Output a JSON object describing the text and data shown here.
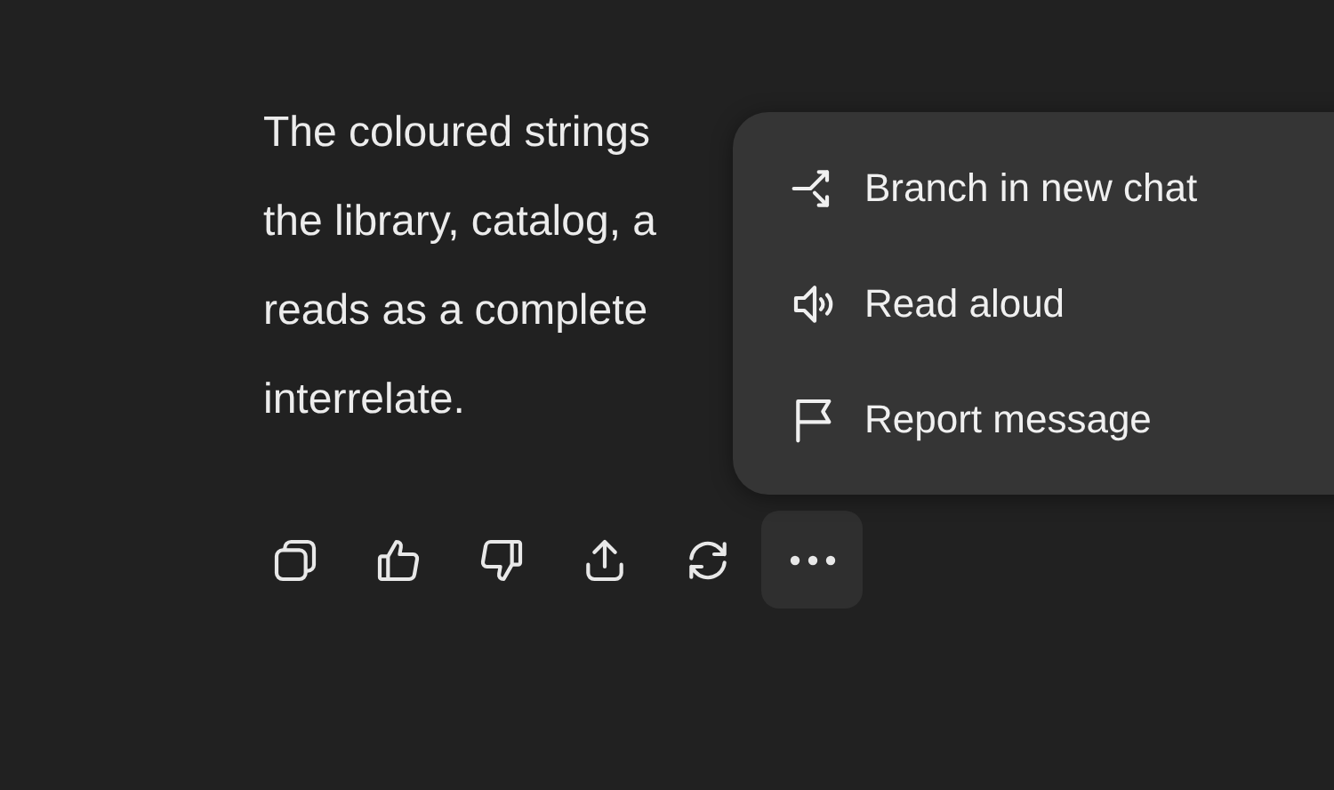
{
  "message": {
    "lines": [
      "The coloured strings",
      "the library, catalog, a",
      "reads as a complete",
      "interrelate."
    ]
  },
  "more_button": {
    "expanded": true
  },
  "menu": {
    "items": [
      {
        "label": "Branch in new chat"
      },
      {
        "label": "Read aloud"
      },
      {
        "label": "Report message"
      }
    ]
  }
}
